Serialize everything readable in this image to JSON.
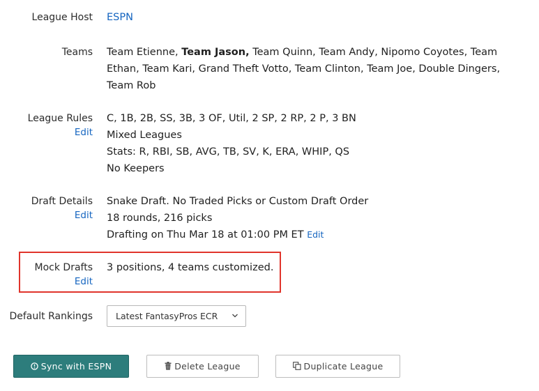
{
  "league_host": {
    "label": "League Host",
    "value": "ESPN"
  },
  "teams": {
    "label": "Teams",
    "lines": [
      {
        "before": "Team Etienne, ",
        "bold": "Team Jason,",
        "after": " Team Quinn, Team Andy, Nipomo Coyotes, Team"
      },
      {
        "text": "Ethan, Team Kari, Grand Theft Votto, Team Clinton, Team Joe, Double Dingers,"
      },
      {
        "text": "Team Rob"
      }
    ]
  },
  "league_rules": {
    "label": "League Rules",
    "edit": "Edit",
    "lines": [
      "C, 1B, 2B, SS, 3B, 3 OF, Util, 2 SP, 2 RP, 2 P, 3 BN",
      "Mixed Leagues",
      "Stats: R, RBI, SB, AVG, TB, SV, K, ERA, WHIP, QS",
      "No Keepers"
    ]
  },
  "draft_details": {
    "label": "Draft Details",
    "edit": "Edit",
    "lines": [
      "Snake Draft. No Traded Picks or Custom Draft Order",
      "18 rounds, 216 picks",
      "Drafting on Thu Mar 18 at 01:00 PM ET"
    ],
    "inline_edit": "Edit"
  },
  "mock_drafts": {
    "label": "Mock Drafts",
    "edit": "Edit",
    "value": "3 positions, 4 teams customized."
  },
  "default_rankings": {
    "label": "Default Rankings",
    "selected": "Latest FantasyPros ECR"
  },
  "buttons": {
    "sync": "Sync with ESPN",
    "delete": "Delete League",
    "duplicate": "Duplicate League"
  },
  "colors": {
    "link": "#1565c0",
    "primary": "#2d7d7c",
    "highlight": "#e0342b"
  }
}
